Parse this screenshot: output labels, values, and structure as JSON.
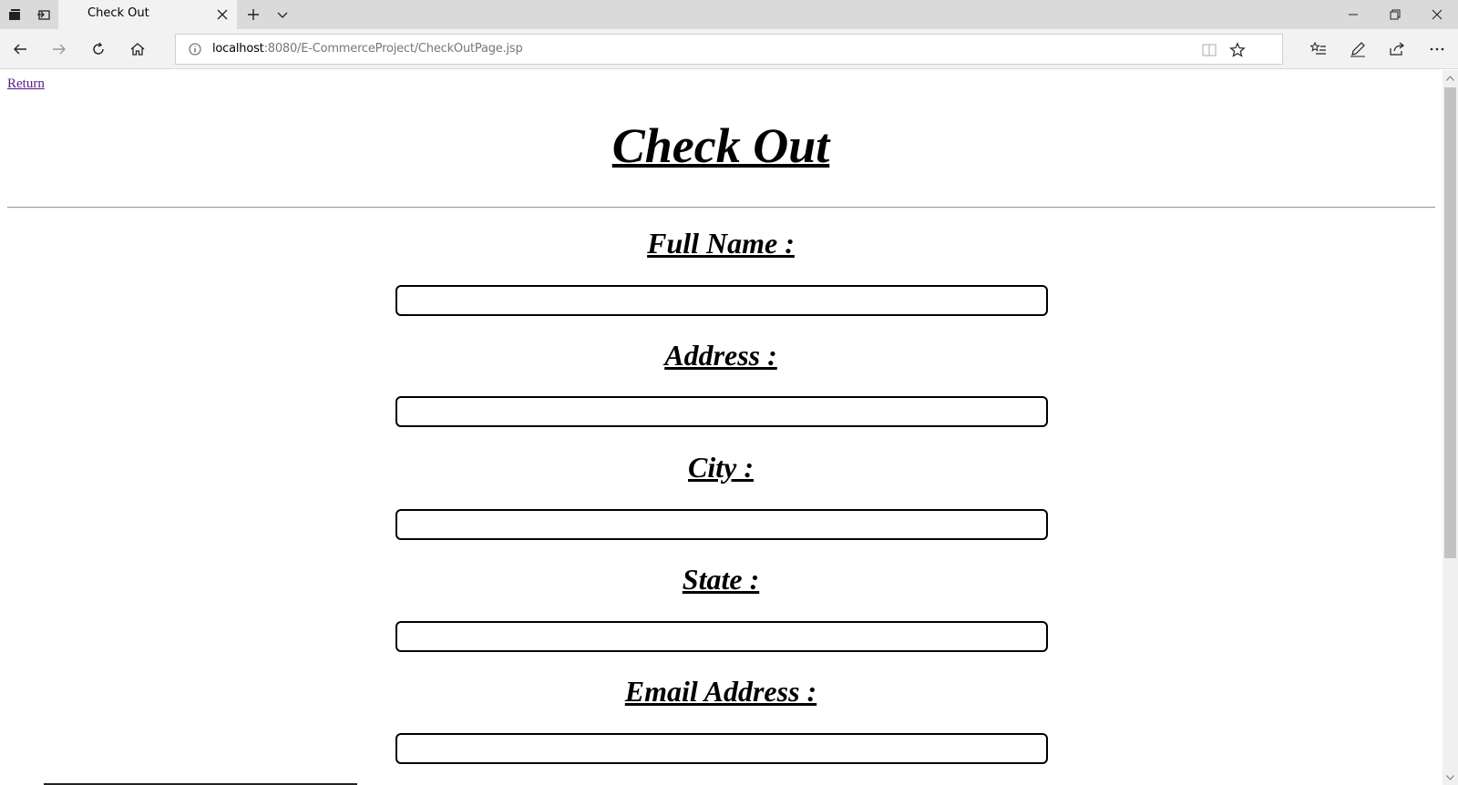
{
  "browser": {
    "tab_title": "Check Out",
    "url_host": "localhost",
    "url_rest": ":8080/E-CommerceProject/CheckOutPage.jsp"
  },
  "page": {
    "return_link": "Return",
    "title": "Check Out",
    "fields": [
      {
        "label": "Full Name :",
        "value": ""
      },
      {
        "label": "Address :",
        "value": ""
      },
      {
        "label": "City :",
        "value": ""
      },
      {
        "label": "State :",
        "value": ""
      },
      {
        "label": "Email Address :",
        "value": ""
      }
    ]
  },
  "colors": {
    "link_visited": "#551a8b",
    "chrome_bg": "#f2f2f2",
    "tabstrip_bg": "#dadada"
  }
}
